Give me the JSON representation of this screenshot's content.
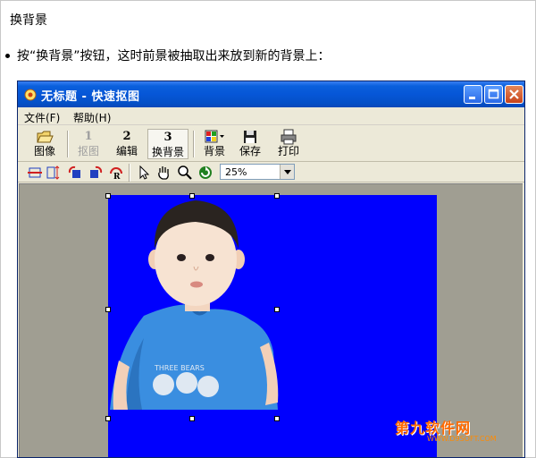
{
  "document": {
    "heading": "换背景",
    "instruction": "按“换背景”按钮，这时前景被抽取出来放到新的背景上："
  },
  "window": {
    "title": "无标题  -  快速抠图",
    "menu": [
      {
        "label": "文件(F)"
      },
      {
        "label": "帮助(H)"
      }
    ],
    "toolbar": {
      "open_label": "图像",
      "step1_num": "1",
      "step1_label": "抠图",
      "step2_num": "2",
      "step2_label": "编辑",
      "step3_num": "3",
      "step3_label": "换背景",
      "background_label": "背景",
      "save_label": "保存",
      "print_label": "打印"
    },
    "zoom": {
      "value": "25%"
    },
    "canvas_color": "#0000fe"
  },
  "watermark": {
    "main": "第九软件网",
    "sub": "WWW.D9SOFT.COM"
  }
}
